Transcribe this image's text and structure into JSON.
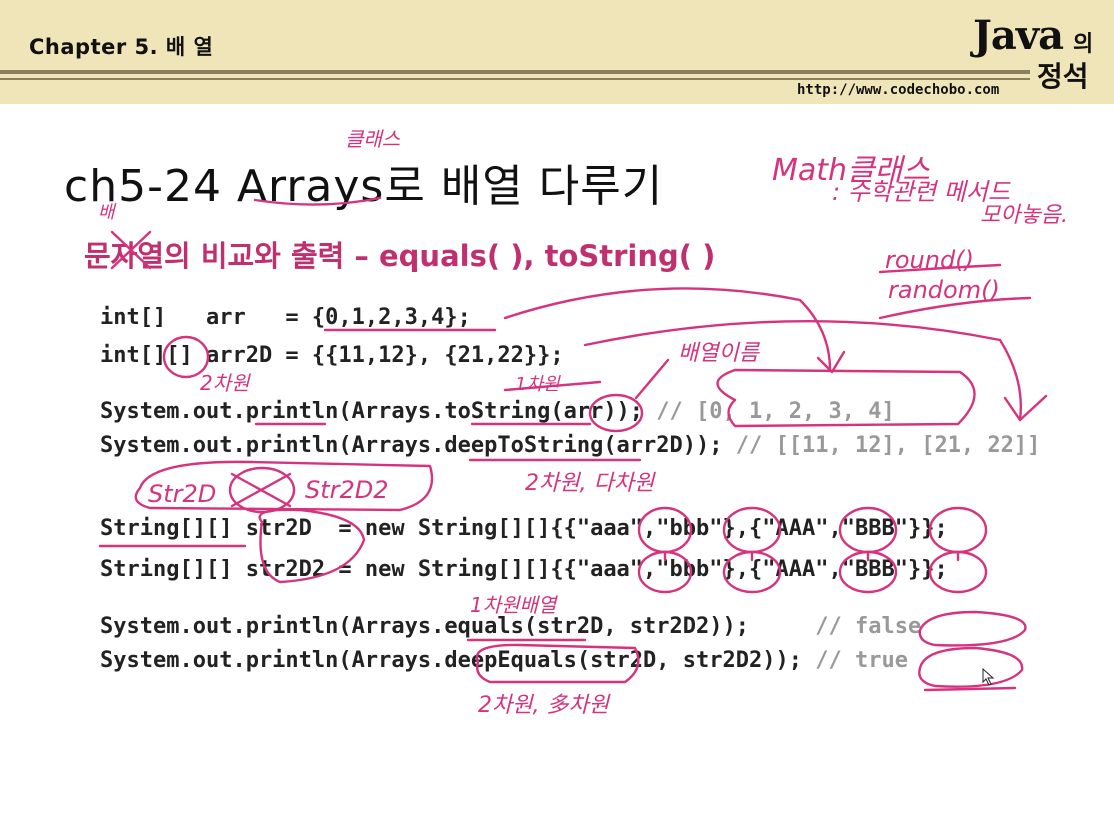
{
  "header": {
    "chapter": "Chapter 5. 배 열",
    "logo_main": "Java",
    "logo_suffix": "의",
    "logo_sub": "정석",
    "url": "http://www.codechobo.com"
  },
  "slide": {
    "title": "ch5-24 Arrays로 배열 다루기",
    "subtitle": "문자열의 비교와 출력 – equals( ), toString( )"
  },
  "code": {
    "line1": "int[]   arr   = {0,1,2,3,4};",
    "line2": "int[][] arr2D = {{11,12}, {21,22}};",
    "line3": "System.out.println(Arrays.toString(arr)); ",
    "line3_comment": "// [0, 1, 2, 3, 4]",
    "line4": "System.out.println(Arrays.deepToString(arr2D)); ",
    "line4_comment": "// [[11, 12], [21, 22]]",
    "line5": "String[][] str2D  = new String[][]{{\"aaa\",\"bbb\"},{\"AAA\",\"BBB\"}};",
    "line6": "String[][] str2D2 = new String[][]{{\"aaa\",\"bbb\"},{\"AAA\",\"BBB\"}};",
    "line7": "System.out.println(Arrays.equals(str2D, str2D2));     ",
    "line7_comment": "// false",
    "line8": "System.out.println(Arrays.deepEquals(str2D, str2D2)); ",
    "line8_comment": "// true"
  },
  "annotations": {
    "class_note": "클래스",
    "math_note_1": "Math클래스",
    "math_note_2": ": 수학관련 메서드",
    "math_note_3": "모아놓음.",
    "round": "round()",
    "random": "random()",
    "arr_name": "배열이름",
    "dim2": "2차원",
    "dim1": "1차원",
    "array_char": "배",
    "dim_note": "2차원, 다차원",
    "str_label_1": "Str2D",
    "str_label_2": "Str2D2",
    "dim1_arr": "1차원배열",
    "deep_note": "2차원, 多차원"
  },
  "colors": {
    "header_bg": "#efe5b8",
    "subtitle": "#c0306f",
    "ink": "#d6337f",
    "comment": "#999999"
  }
}
